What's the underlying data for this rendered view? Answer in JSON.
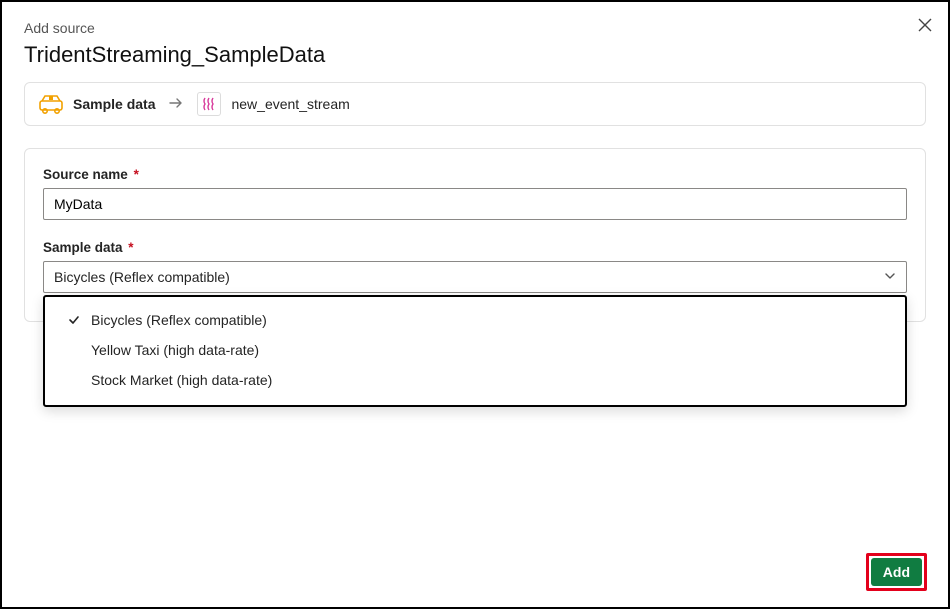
{
  "header": {
    "sub": "Add source",
    "title": "TridentStreaming_SampleData"
  },
  "breadcrumb": {
    "source_label": "Sample data",
    "target_label": "new_event_stream"
  },
  "form": {
    "source_name": {
      "label": "Source name",
      "required_mark": "*",
      "value": "MyData"
    },
    "sample_data": {
      "label": "Sample data",
      "required_mark": "*",
      "selected": "Bicycles (Reflex compatible)",
      "options": [
        "Bicycles (Reflex compatible)",
        "Yellow Taxi (high data-rate)",
        "Stock Market (high data-rate)"
      ]
    }
  },
  "actions": {
    "add": "Add"
  }
}
